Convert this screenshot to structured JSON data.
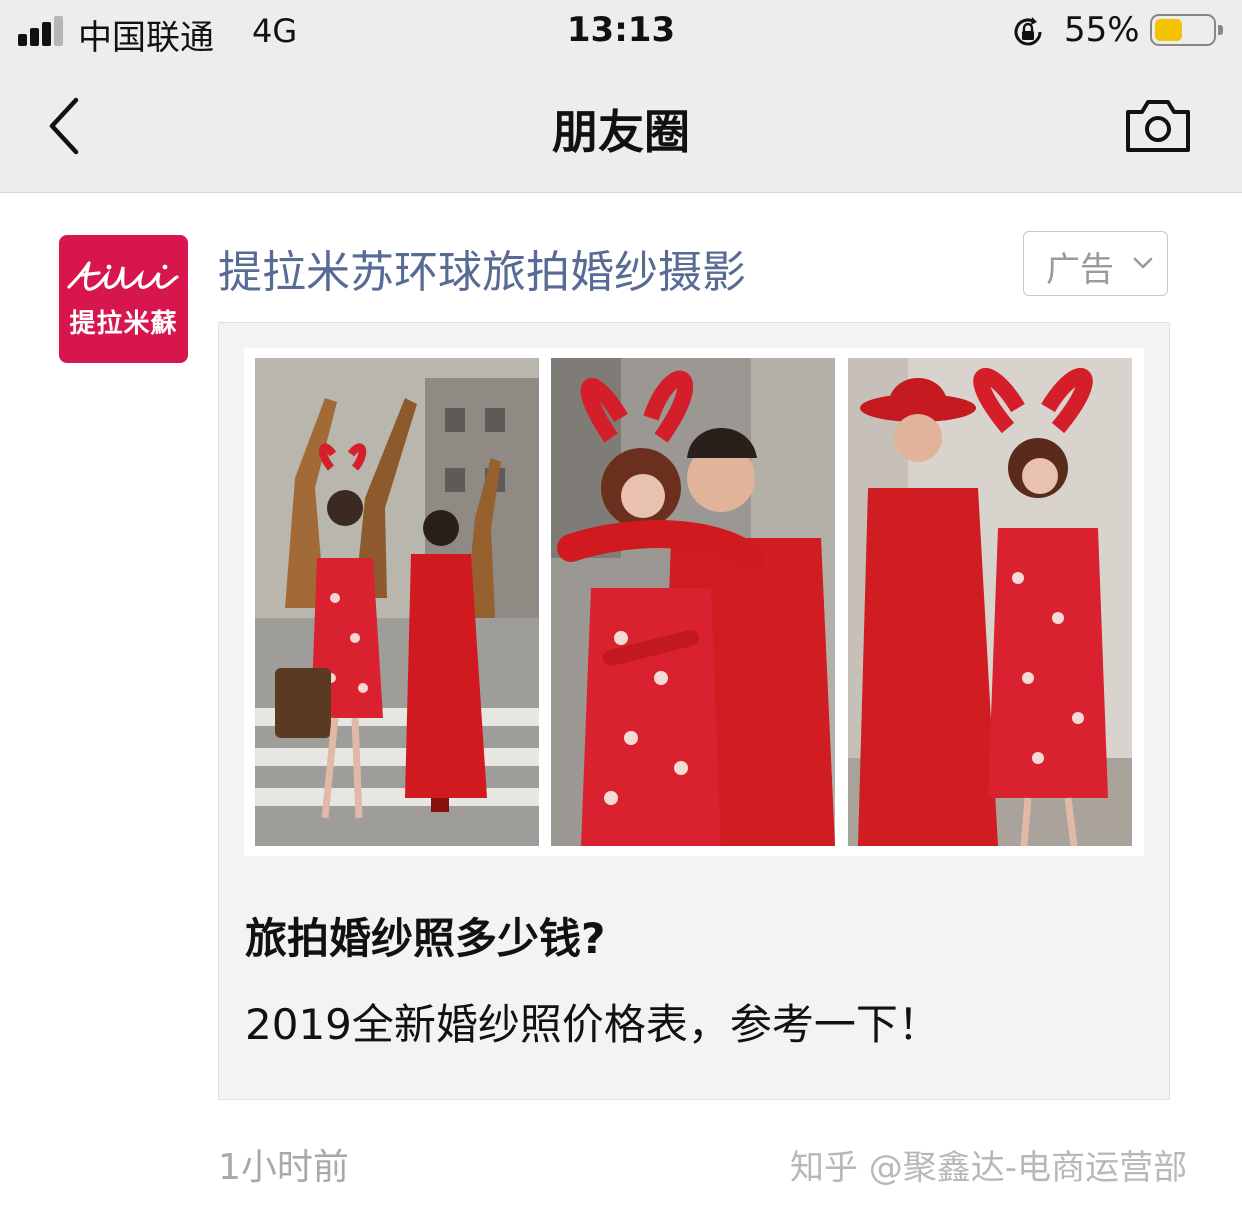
{
  "status_bar": {
    "carrier": "中国联通",
    "network": "4G",
    "time": "13:13",
    "battery_percent": "55%",
    "battery_level": 0.55,
    "signal_bars": 3,
    "icons": [
      "signal-icon",
      "orientation-lock-icon",
      "battery-icon"
    ],
    "colors": {
      "battery_fill": "#f5c400"
    }
  },
  "nav": {
    "title": "朋友圈",
    "back_icon": "chevron-left-icon",
    "camera_icon": "camera-icon"
  },
  "post": {
    "avatar_text": "提拉米蘇",
    "account_name": "提拉米苏环球旅拍婚纱摄影",
    "ad_label": "广告",
    "ad_icon": "chevron-down-icon",
    "card": {
      "title": "旅拍婚纱照多少钱?",
      "description": "2019全新婚纱照价格表，参考一下！",
      "photos": [
        "couple-with-giraffes-street-photo",
        "couple-embrace-red-outfits-photo",
        "couple-red-hat-walking-photo"
      ]
    },
    "timestamp": "1小时前"
  },
  "watermark": "知乎 @聚鑫达-电商运营部",
  "colors": {
    "link": "#576b95",
    "nav_bg": "#ededed",
    "avatar_bg": "#d6164c",
    "card_bg": "#f3f3f5"
  }
}
